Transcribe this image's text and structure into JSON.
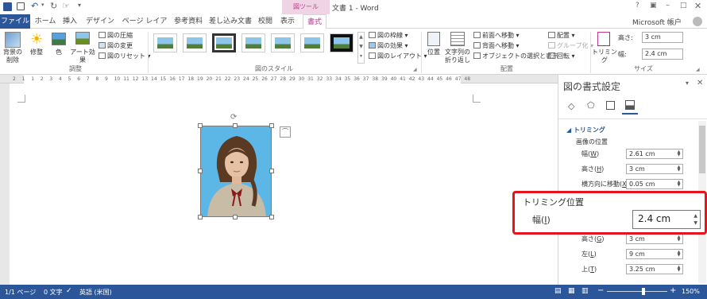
{
  "title_bar": {
    "context_tab_group": "図ツール",
    "document_title": "文書 1 - Word"
  },
  "tabs": [
    "ファイル",
    "ホーム",
    "挿入",
    "デザイン",
    "ページ レイアウト",
    "参考資料",
    "差し込み文書",
    "校閲",
    "表示",
    "書式"
  ],
  "account": "Microsoft 帳户",
  "ribbon": {
    "remove_bg": [
      "背景の",
      "削除"
    ],
    "corrections": "修整",
    "color": "色",
    "artistic": "アート効果",
    "compress": "図の圧縮",
    "change": "図の変更",
    "reset": "図のリセット",
    "group_adjust": "調整",
    "group_styles": "図のスタイル",
    "border": "図の枠線",
    "effects": "図の効果",
    "layout": "図のレイアウト",
    "position": "位置",
    "wrap": [
      "文字列の",
      "折り返し"
    ],
    "forward": "前面へ移動",
    "backward": "背面へ移動",
    "selection": "オブジェクトの選択と表示",
    "align": "配置",
    "group_obj": "グループ化",
    "rotate": "回転",
    "group_arrange": "配置",
    "crop": "トリミング",
    "height_label": "高さ:",
    "height_value": "3 cm",
    "width_label": "幅:",
    "width_value": "2.4 cm",
    "group_size": "サイズ"
  },
  "ruler_numbers": [
    "2",
    "1",
    "1",
    "2",
    "3",
    "4",
    "5",
    "6",
    "7",
    "8",
    "9",
    "10",
    "11",
    "12",
    "13",
    "14",
    "15",
    "16",
    "17",
    "18",
    "19",
    "20",
    "21",
    "22",
    "23",
    "24",
    "25",
    "26",
    "27",
    "28",
    "29",
    "30",
    "31",
    "32",
    "33",
    "34",
    "35",
    "36",
    "37",
    "38",
    "39",
    "40",
    "41",
    "42",
    "43",
    "44",
    "45",
    "46",
    "47",
    "48"
  ],
  "pane": {
    "title": "図の書式設定",
    "section": "トリミング",
    "subsection": "画像の位置",
    "rows": [
      {
        "label": "幅(W)",
        "value": "2.61 cm"
      },
      {
        "label": "高さ(H)",
        "value": "3 cm"
      },
      {
        "label": "横方向に移動(X)",
        "value": "0.05 cm"
      },
      {
        "label": "高さ(G)",
        "value": "3 cm"
      },
      {
        "label": "左(L)",
        "value": "9 cm"
      },
      {
        "label": "上(T)",
        "value": "3.25 cm"
      }
    ]
  },
  "callout": {
    "title": "トリミング位置",
    "label": "幅(I)",
    "value": "2.4 cm"
  },
  "status": {
    "page": "1/1 ページ",
    "words": "0 文字",
    "language": "英語 (米国)",
    "zoom": "150%"
  },
  "colors": {
    "accent": "#2b579a",
    "context_tab": "#bb3b8c",
    "highlight": "#e8141b"
  }
}
